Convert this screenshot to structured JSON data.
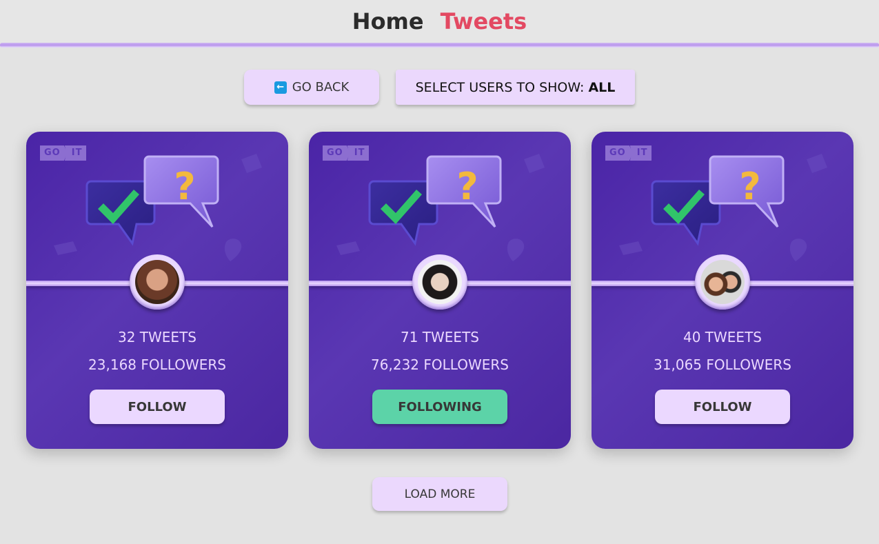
{
  "header": {
    "nav": [
      {
        "label": "Home",
        "active": false
      },
      {
        "label": "Tweets",
        "active": true
      }
    ],
    "active_color": "#e34962"
  },
  "controls": {
    "go_back_label": "Go back",
    "go_back_icon": "arrow-left-icon",
    "select_label": "Select users to show:",
    "select_value": "ALL"
  },
  "cards": [
    {
      "logo": [
        "GO",
        "IT"
      ],
      "tweets": "32 tweets",
      "followers": "23,168 followers",
      "button_label": "Follow",
      "following": false,
      "avatar": "user-avatar-woman"
    },
    {
      "logo": [
        "GO",
        "IT"
      ],
      "tweets": "71 tweets",
      "followers": "76,232 followers",
      "button_label": "Following",
      "following": true,
      "avatar": "user-avatar-man-sunglasses"
    },
    {
      "logo": [
        "GO",
        "IT"
      ],
      "tweets": "40 tweets",
      "followers": "31,065 followers",
      "button_label": "Follow",
      "following": false,
      "avatar": "user-avatar-couple"
    }
  ],
  "load_more_label": "Load more",
  "colors": {
    "card_bg": "#4b27a1",
    "button_light": "#ebd8ff",
    "button_following": "#5cd3a8"
  }
}
